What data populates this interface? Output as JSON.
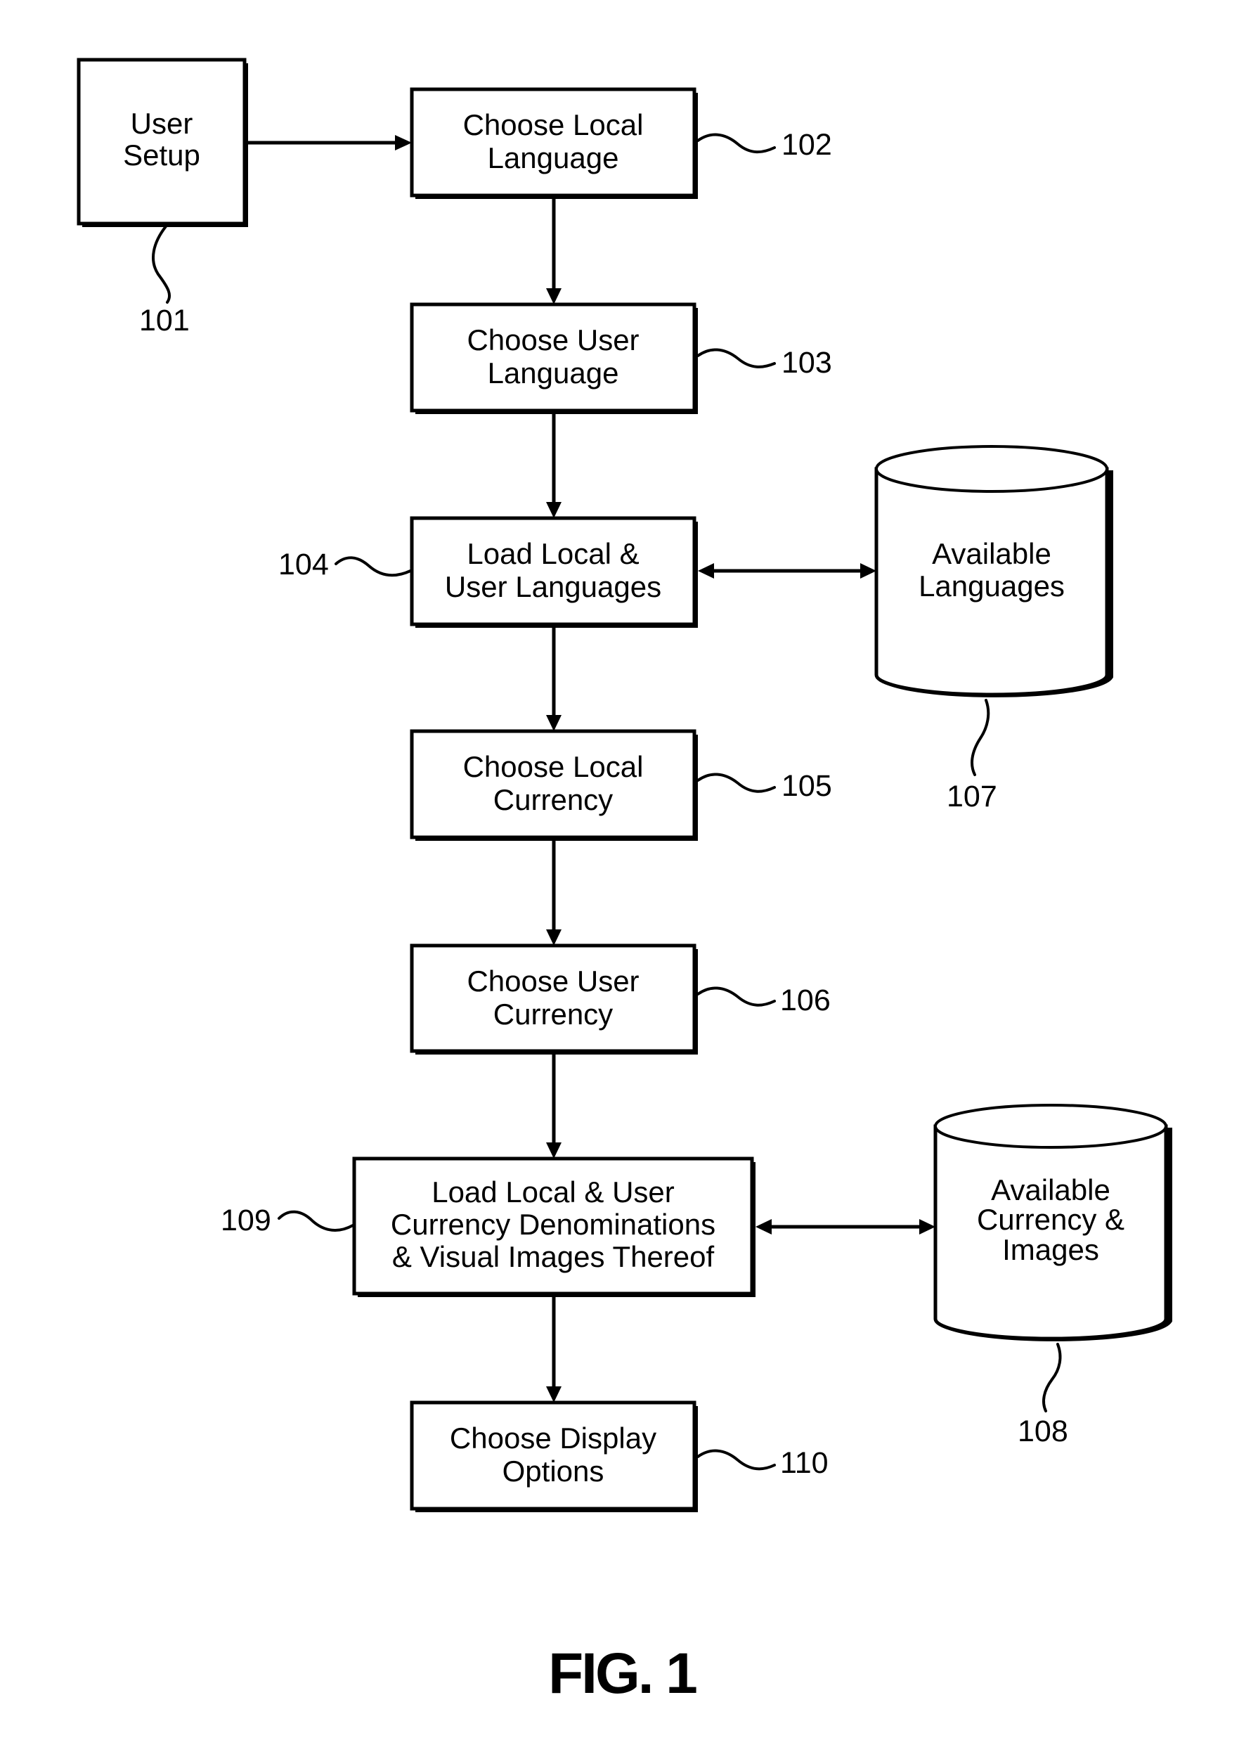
{
  "figure": {
    "caption": "FIG. 1",
    "type": "flowchart"
  },
  "nodes": [
    {
      "id": "101",
      "kind": "process",
      "lines": [
        "User",
        "Setup"
      ],
      "ref": "101"
    },
    {
      "id": "102",
      "kind": "process",
      "lines": [
        "Choose Local",
        "Language"
      ],
      "ref": "102"
    },
    {
      "id": "103",
      "kind": "process",
      "lines": [
        "Choose User",
        "Language"
      ],
      "ref": "103"
    },
    {
      "id": "104",
      "kind": "process",
      "lines": [
        "Load Local &",
        "User Languages"
      ],
      "ref": "104"
    },
    {
      "id": "105",
      "kind": "process",
      "lines": [
        "Choose Local",
        "Currency"
      ],
      "ref": "105"
    },
    {
      "id": "106",
      "kind": "process",
      "lines": [
        "Choose User",
        "Currency"
      ],
      "ref": "106"
    },
    {
      "id": "109",
      "kind": "process",
      "lines": [
        "Load Local & User",
        "Currency Denominations",
        "& Visual Images Thereof"
      ],
      "ref": "109"
    },
    {
      "id": "110",
      "kind": "process",
      "lines": [
        "Choose Display",
        "Options"
      ],
      "ref": "110"
    },
    {
      "id": "107",
      "kind": "database",
      "lines": [
        "Available",
        "Languages"
      ],
      "ref": "107"
    },
    {
      "id": "108",
      "kind": "database",
      "lines": [
        "Available",
        "Currency &",
        "Images"
      ],
      "ref": "108"
    }
  ],
  "edges": [
    {
      "from": "101",
      "to": "102",
      "direction": "forward"
    },
    {
      "from": "102",
      "to": "103",
      "direction": "forward"
    },
    {
      "from": "103",
      "to": "104",
      "direction": "forward"
    },
    {
      "from": "104",
      "to": "107",
      "direction": "bidirectional"
    },
    {
      "from": "104",
      "to": "105",
      "direction": "forward"
    },
    {
      "from": "105",
      "to": "106",
      "direction": "forward"
    },
    {
      "from": "106",
      "to": "109",
      "direction": "forward"
    },
    {
      "from": "109",
      "to": "108",
      "direction": "bidirectional"
    },
    {
      "from": "109",
      "to": "110",
      "direction": "forward"
    }
  ]
}
